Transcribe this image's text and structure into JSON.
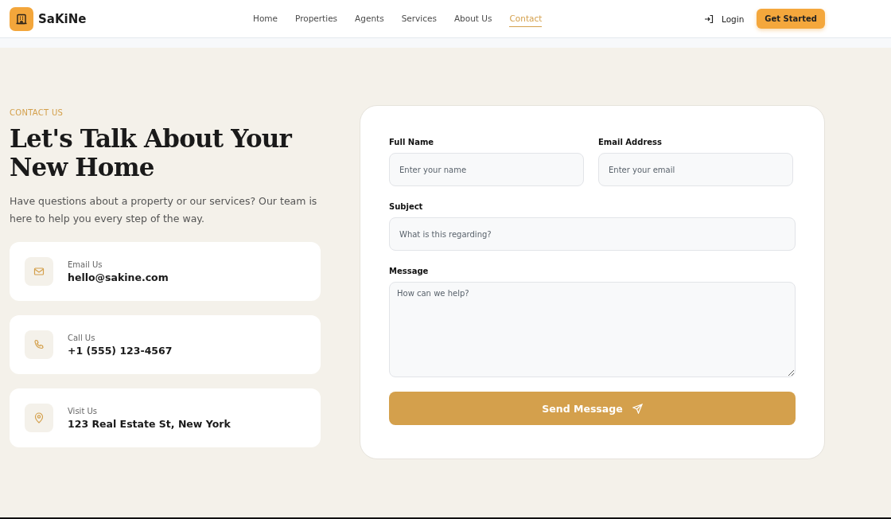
{
  "header": {
    "brand": "SaKiNe",
    "nav": [
      {
        "label": "Home",
        "selected": false
      },
      {
        "label": "Properties",
        "selected": false
      },
      {
        "label": "Agents",
        "selected": false
      },
      {
        "label": "Services",
        "selected": false
      },
      {
        "label": "About Us",
        "selected": false
      },
      {
        "label": "Contact",
        "selected": true
      }
    ],
    "login": "Login",
    "cta": "Get Started"
  },
  "intro": {
    "eyebrow": "CONTACT US",
    "title_lines": [
      "Let's Talk About Your",
      "New Home"
    ],
    "text": "Have questions about a property or our services? Our team is here to help you every step of the way."
  },
  "contacts": [
    {
      "kind": "email",
      "label": "Email Us",
      "value": "hello@sakine.com"
    },
    {
      "kind": "phone",
      "label": "Call Us",
      "value": "+1 (555) 123-4567"
    },
    {
      "kind": "location",
      "label": "Visit Us",
      "value": "123 Real Estate St, New York"
    }
  ],
  "form": {
    "fields": [
      {
        "kind": "input",
        "label": "Full Name",
        "placeholder": "Enter your name",
        "half": true
      },
      {
        "kind": "input",
        "label": "Email Address",
        "placeholder": "Enter your email",
        "half": true
      },
      {
        "kind": "input",
        "label": "Subject",
        "placeholder": "What is this regarding?",
        "half": false
      },
      {
        "kind": "textarea",
        "label": "Message",
        "placeholder": "How can we help?",
        "half": false
      }
    ],
    "submit": "Send Message"
  }
}
